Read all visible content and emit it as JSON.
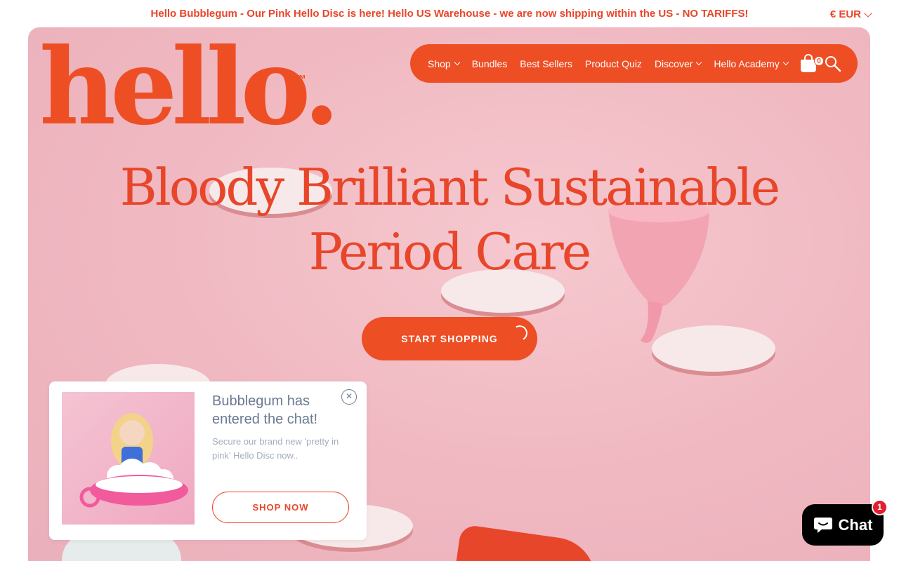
{
  "announcement": {
    "text": "Hello Bubblegum - Our Pink Hello Disc is here! Hello US Warehouse - we are now shipping within the US - NO TARIFFS!",
    "currency": "€ EUR"
  },
  "brand": {
    "logo_text": "hello.",
    "trademark": "™",
    "primary_color": "#ee4e24",
    "hero_bg": "#f0b8c1"
  },
  "nav": {
    "items": [
      {
        "label": "Shop",
        "dropdown": true
      },
      {
        "label": "Bundles",
        "dropdown": false
      },
      {
        "label": "Best Sellers",
        "dropdown": false
      },
      {
        "label": "Product Quiz",
        "dropdown": false
      },
      {
        "label": "Discover",
        "dropdown": true
      },
      {
        "label": "Hello Academy",
        "dropdown": true
      }
    ],
    "cart_count": "0",
    "cart_icon": "shopping-bag-icon",
    "search_icon": "search-icon"
  },
  "hero": {
    "headline_line1": "Bloody Brilliant Sustainable",
    "headline_line2": "Period Care",
    "cta_label": "START SHOPPING"
  },
  "popup": {
    "title": "Bubblegum has entered the chat!",
    "subtitle": "Secure our brand new 'pretty in pink' Hello Disc now..",
    "button_label": "SHOP NOW",
    "close_icon": "close-icon"
  },
  "chat": {
    "label": "Chat",
    "badge": "1",
    "icon": "chat-bubble-icon"
  }
}
